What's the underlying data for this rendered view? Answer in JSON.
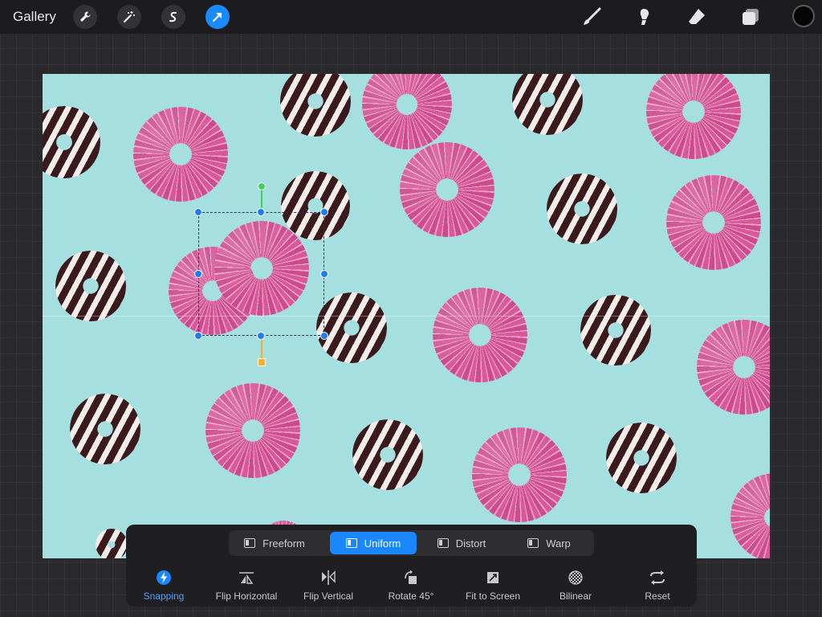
{
  "topbar": {
    "gallery_label": "Gallery",
    "tools_left": [
      "wrench-icon",
      "magic-wand-icon",
      "selection-s-icon",
      "transform-arrow-icon"
    ],
    "tools_right": [
      "brush-icon",
      "smudge-icon",
      "eraser-icon",
      "layers-icon"
    ],
    "active_tool": "transform-arrow-icon",
    "color_well": "#050505"
  },
  "transform_modes": [
    {
      "label": "Freeform",
      "active": false
    },
    {
      "label": "Uniform",
      "active": true
    },
    {
      "label": "Distort",
      "active": false
    },
    {
      "label": "Warp",
      "active": false
    }
  ],
  "actions": [
    {
      "label": "Snapping",
      "icon": "snapping-bolt-icon",
      "active": true
    },
    {
      "label": "Flip Horizontal",
      "icon": "flip-horizontal-icon"
    },
    {
      "label": "Flip Vertical",
      "icon": "flip-vertical-icon"
    },
    {
      "label": "Rotate 45°",
      "icon": "rotate-45-icon"
    },
    {
      "label": "Fit to Screen",
      "icon": "fit-to-screen-icon"
    },
    {
      "label": "Bilinear",
      "icon": "bilinear-icon"
    },
    {
      "label": "Reset",
      "icon": "reset-icon"
    }
  ],
  "colors": {
    "accent": "#1a86ff",
    "canvas_bg": "#a5dfe0",
    "rotation_handle": "#3fd05a",
    "resize_handle": "#f5b02a"
  }
}
